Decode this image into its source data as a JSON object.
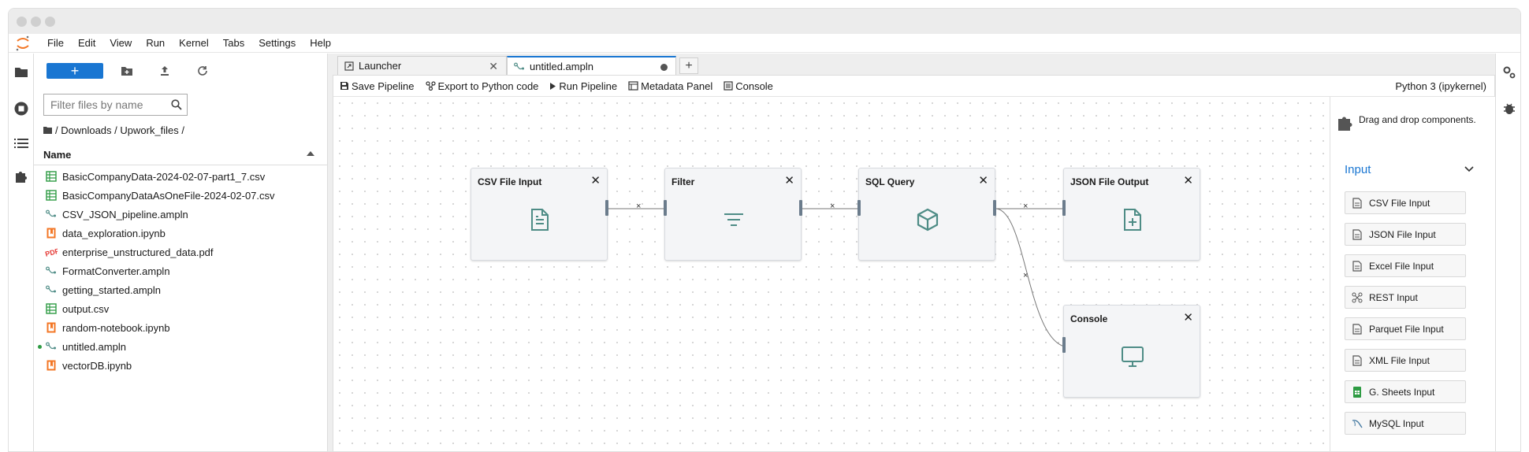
{
  "menu": [
    "File",
    "Edit",
    "View",
    "Run",
    "Kernel",
    "Tabs",
    "Settings",
    "Help"
  ],
  "filebrowser": {
    "new_label": "+",
    "filter_placeholder": "Filter files by name",
    "breadcrumb": "/ Downloads / Upwork_files /",
    "column_name": "Name",
    "files": [
      {
        "name": "BasicCompanyData-2024-02-07-part1_7.csv",
        "type": "csv",
        "running": false
      },
      {
        "name": "BasicCompanyDataAsOneFile-2024-02-07.csv",
        "type": "csv",
        "running": false
      },
      {
        "name": "CSV_JSON_pipeline.ampln",
        "type": "ampln",
        "running": false
      },
      {
        "name": "data_exploration.ipynb",
        "type": "ipynb",
        "running": false
      },
      {
        "name": "enterprise_unstructured_data.pdf",
        "type": "pdf",
        "running": false
      },
      {
        "name": "FormatConverter.ampln",
        "type": "ampln",
        "running": false
      },
      {
        "name": "getting_started.ampln",
        "type": "ampln",
        "running": false
      },
      {
        "name": "output.csv",
        "type": "csv",
        "running": false
      },
      {
        "name": "random-notebook.ipynb",
        "type": "ipynb",
        "running": false
      },
      {
        "name": "untitled.ampln",
        "type": "ampln",
        "running": true
      },
      {
        "name": "vectorDB.ipynb",
        "type": "ipynb",
        "running": false
      }
    ]
  },
  "tabs": {
    "launcher": "Launcher",
    "active": "untitled.ampln",
    "add": "+"
  },
  "toolbar": {
    "save": "Save Pipeline",
    "export": "Export to Python code",
    "run": "Run Pipeline",
    "metadata": "Metadata Panel",
    "console": "Console",
    "kernel": "Python 3 (ipykernel)"
  },
  "nodes": {
    "csv": "CSV File Input",
    "filter": "Filter",
    "sql": "SQL Query",
    "json": "JSON File Output",
    "console": "Console"
  },
  "edge_marker": "×",
  "palette": {
    "hint": "Drag and drop components.",
    "section": "Input",
    "items": [
      "CSV File Input",
      "JSON File Input",
      "Excel File Input",
      "REST Input",
      "Parquet File Input",
      "XML File Input",
      "G. Sheets Input",
      "MySQL Input"
    ]
  },
  "colors": {
    "accent": "#1976d2",
    "node_icon": "#4e8c86",
    "csv_icon": "#2e9b43",
    "ipynb_icon": "#f37726",
    "pdf_icon": "#e53935"
  }
}
